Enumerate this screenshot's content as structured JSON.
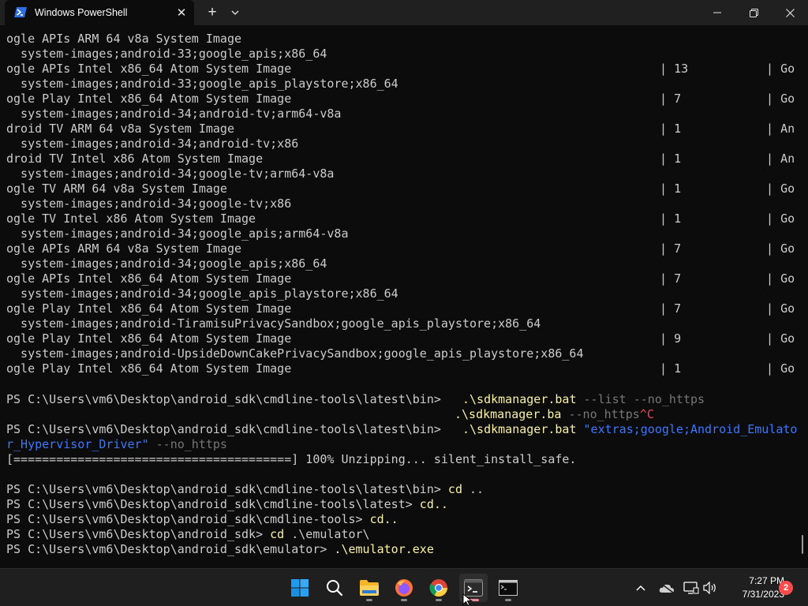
{
  "window": {
    "tab_title": "Windows PowerShell",
    "tab_icon": "powershell-icon",
    "controls": [
      "minimize-icon",
      "maximize-icon",
      "close-icon"
    ]
  },
  "terminal": {
    "package_rows": [
      {
        "cont": "ogle APIs ARM 64 v8a System Image",
        "path": "  system-images;android-33;google_apis;x86_64",
        "ver": "13",
        "desc": "Go"
      },
      {
        "cont": "ogle APIs Intel x86_64 Atom System Image",
        "path": "  system-images;android-33;google_apis_playstore;x86_64",
        "ver": "7",
        "desc": "Go"
      },
      {
        "cont": "ogle Play Intel x86_64 Atom System Image",
        "path": "  system-images;android-34;android-tv;arm64-v8a",
        "ver": "1",
        "desc": "An"
      },
      {
        "cont": "droid TV ARM 64 v8a System Image",
        "path": "  system-images;android-34;android-tv;x86",
        "ver": "1",
        "desc": "An"
      },
      {
        "cont": "droid TV Intel x86 Atom System Image",
        "path": "  system-images;android-34;google-tv;arm64-v8a",
        "ver": "1",
        "desc": "Go"
      },
      {
        "cont": "ogle TV ARM 64 v8a System Image",
        "path": "  system-images;android-34;google-tv;x86",
        "ver": "1",
        "desc": "Go"
      },
      {
        "cont": "ogle TV Intel x86 Atom System Image",
        "path": "  system-images;android-34;google_apis;arm64-v8a",
        "ver": "7",
        "desc": "Go"
      },
      {
        "cont": "ogle APIs ARM 64 v8a System Image",
        "path": "  system-images;android-34;google_apis;x86_64",
        "ver": "7",
        "desc": "Go"
      },
      {
        "cont": "ogle APIs Intel x86_64 Atom System Image",
        "path": "  system-images;android-34;google_apis_playstore;x86_64",
        "ver": "7",
        "desc": "Go"
      },
      {
        "cont": "ogle Play Intel x86_64 Atom System Image",
        "path": "  system-images;android-TiramisuPrivacySandbox;google_apis_playstore;x86_64",
        "ver": "9",
        "desc": "Go"
      },
      {
        "cont": "ogle Play Intel x86_64 Atom System Image",
        "path": "  system-images;android-UpsideDownCakePrivacySandbox;google_apis_playstore;x86_64",
        "ver": "1",
        "desc": "Go"
      }
    ],
    "last_continuation": "ogle Play Intel x86_64 Atom System Image",
    "sep": "| ",
    "prompt_bin": "PS C:\\Users\\vm6\\Desktop\\android_sdk\\cmdline-tools\\latest\\bin> ",
    "cmd1": {
      "exe": ".\\sdkmanager.bat",
      "args": " --list --no_https"
    },
    "cmd1b": {
      "exe": ".\\sdkmanager.ba",
      "args": " --no_https",
      "ctrl": "^C"
    },
    "cmd2": {
      "exe": ".\\sdkmanager.bat",
      "str_a": " \"extras;google;Android_Emulato",
      "str_b": "r_Hypervisor_Driver\"",
      "args": " --no_https"
    },
    "progress_line": "[=======================================] 100% Unzipping... silent_install_safe.",
    "history": [
      {
        "prompt": "PS C:\\Users\\vm6\\Desktop\\android_sdk\\cmdline-tools\\latest\\bin> ",
        "cmd": "cd",
        "args": " .."
      },
      {
        "prompt": "PS C:\\Users\\vm6\\Desktop\\android_sdk\\cmdline-tools\\latest> ",
        "cmd": "cd..",
        "args": ""
      },
      {
        "prompt": "PS C:\\Users\\vm6\\Desktop\\android_sdk\\cmdline-tools> ",
        "cmd": "cd..",
        "args": ""
      },
      {
        "prompt": "PS C:\\Users\\vm6\\Desktop\\android_sdk> ",
        "cmd": "cd",
        "args": " .\\emulator\\"
      },
      {
        "prompt": "PS C:\\Users\\vm6\\Desktop\\android_sdk\\emulator> ",
        "cmd": ".\\emulator.exe",
        "args": ""
      }
    ]
  },
  "taskbar": {
    "apps": [
      "windows-start-icon",
      "search-icon",
      "file-explorer-icon",
      "firefox-icon",
      "chrome-icon",
      "terminal-icon",
      "console-icon"
    ],
    "tray": [
      "chevron-up-icon",
      "onedrive-icon",
      "network-icon",
      "speaker-icon"
    ],
    "clock_time": "7:27 PM",
    "clock_date": "7/31/2023",
    "notification_count": "2"
  }
}
